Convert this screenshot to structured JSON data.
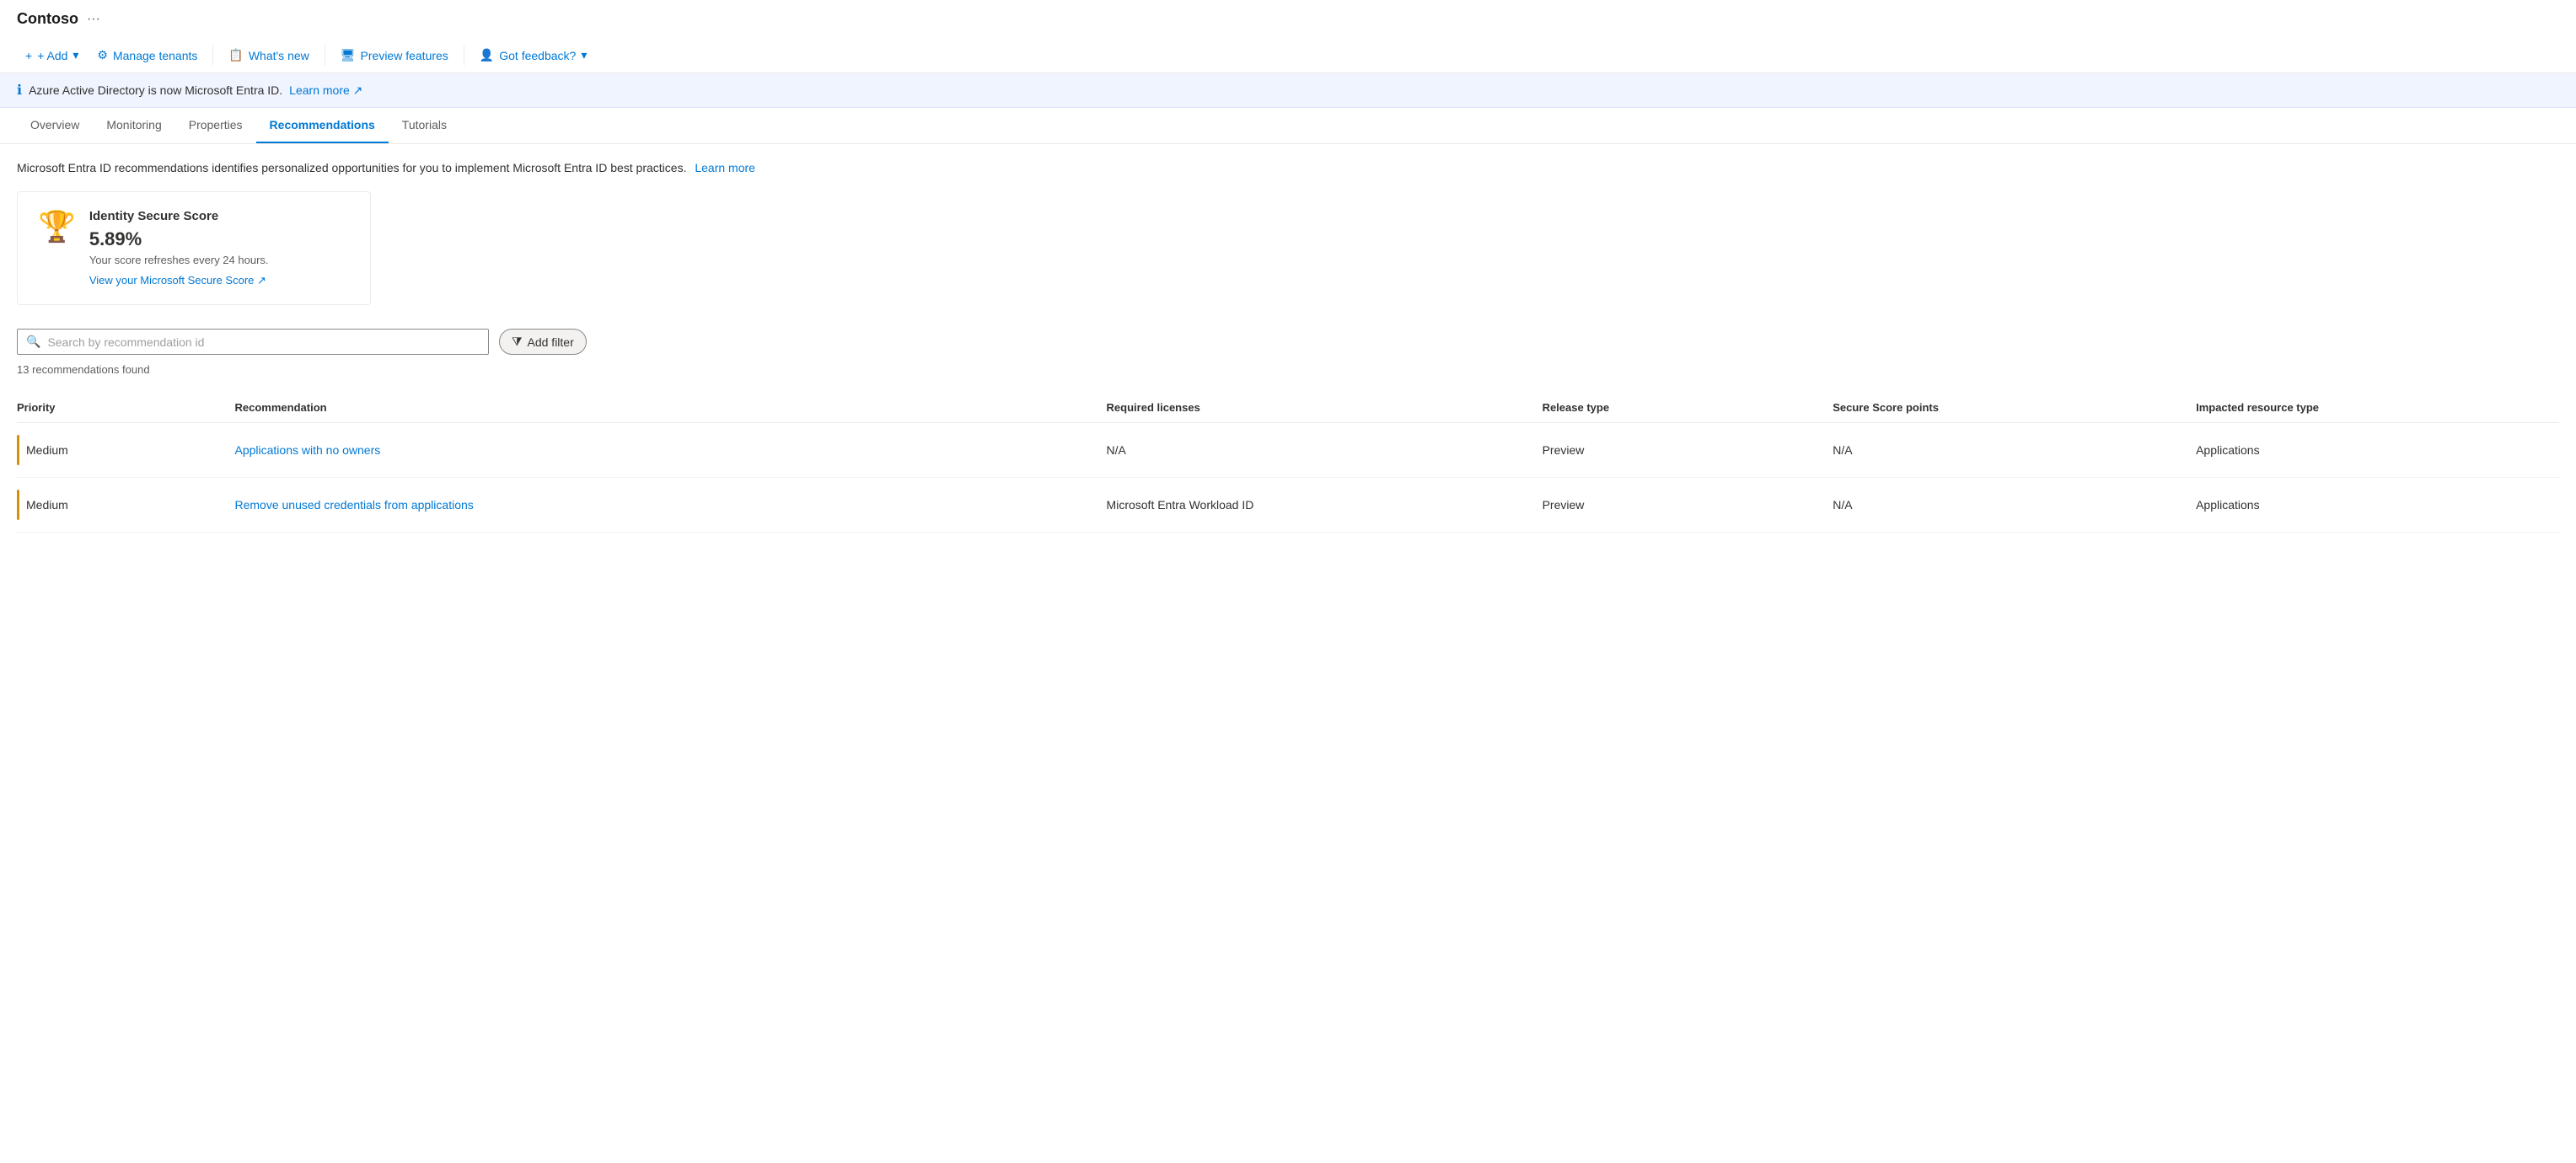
{
  "header": {
    "tenant": "Contoso",
    "ellipsis": "···"
  },
  "toolbar": {
    "add_label": "+ Add",
    "manage_tenants_label": "Manage tenants",
    "whats_new_label": "What's new",
    "preview_features_label": "Preview features",
    "got_feedback_label": "Got feedback?"
  },
  "banner": {
    "text": "Azure Active Directory is now Microsoft Entra ID.",
    "learn_more_label": "Learn more",
    "external_icon": "↗"
  },
  "tabs": [
    {
      "label": "Overview",
      "active": false
    },
    {
      "label": "Monitoring",
      "active": false
    },
    {
      "label": "Properties",
      "active": false
    },
    {
      "label": "Recommendations",
      "active": true
    },
    {
      "label": "Tutorials",
      "active": false
    }
  ],
  "main": {
    "description": "Microsoft Entra ID recommendations identifies personalized opportunities for you to implement Microsoft Entra ID best practices.",
    "description_link": "Learn more",
    "score_card": {
      "title": "Identity Secure Score",
      "value": "5.89%",
      "refresh_text": "Your score refreshes every 24 hours.",
      "link_label": "View your Microsoft Secure Score ↗"
    },
    "search_placeholder": "Search by recommendation id",
    "add_filter_label": "Add filter",
    "results_count": "13 recommendations found",
    "table": {
      "headers": [
        "Priority",
        "Recommendation",
        "Required licenses",
        "Release type",
        "Secure Score points",
        "Impacted resource type"
      ],
      "rows": [
        {
          "priority": "Medium",
          "recommendation": "Applications with no owners",
          "licenses": "N/A",
          "release": "Preview",
          "score_points": "N/A",
          "resource_type": "Applications"
        },
        {
          "priority": "Medium",
          "recommendation": "Remove unused credentials from applications",
          "licenses": "Microsoft Entra Workload ID",
          "release": "Preview",
          "score_points": "N/A",
          "resource_type": "Applications"
        }
      ]
    }
  }
}
